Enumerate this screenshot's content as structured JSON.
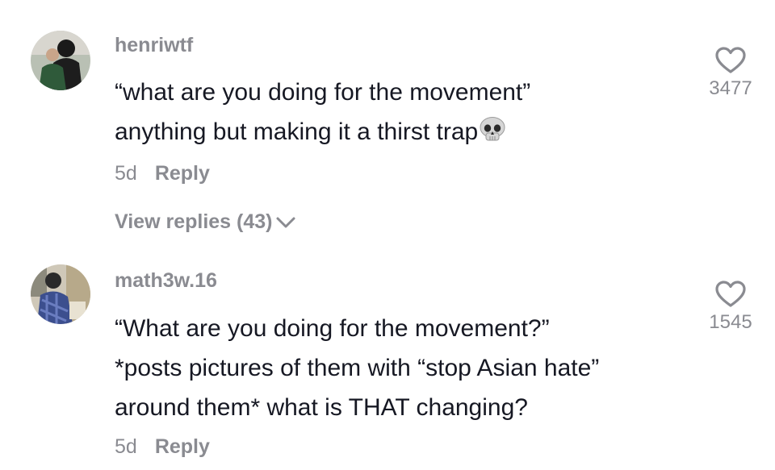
{
  "comments": [
    {
      "username": "henriwtf",
      "lines": [
        "“what are you doing for the movement”",
        "anything but making it a thirst trap"
      ],
      "emoji": "skull-emoji",
      "time": "5d",
      "reply_label": "Reply",
      "likes": "3477",
      "view_replies": "View replies (43)"
    },
    {
      "username": "math3w.16",
      "lines": [
        "“What are you doing for the movement?”",
        "*posts pictures of them with “stop Asian hate”",
        "around them* what is THAT changing?"
      ],
      "time": "5d",
      "reply_label": "Reply",
      "likes": "1545"
    }
  ],
  "icons": {
    "like": "heart-outline-icon",
    "expand": "chevron-down-icon"
  },
  "colors": {
    "primary_text": "#161823",
    "secondary_text": "#8a8b91"
  }
}
